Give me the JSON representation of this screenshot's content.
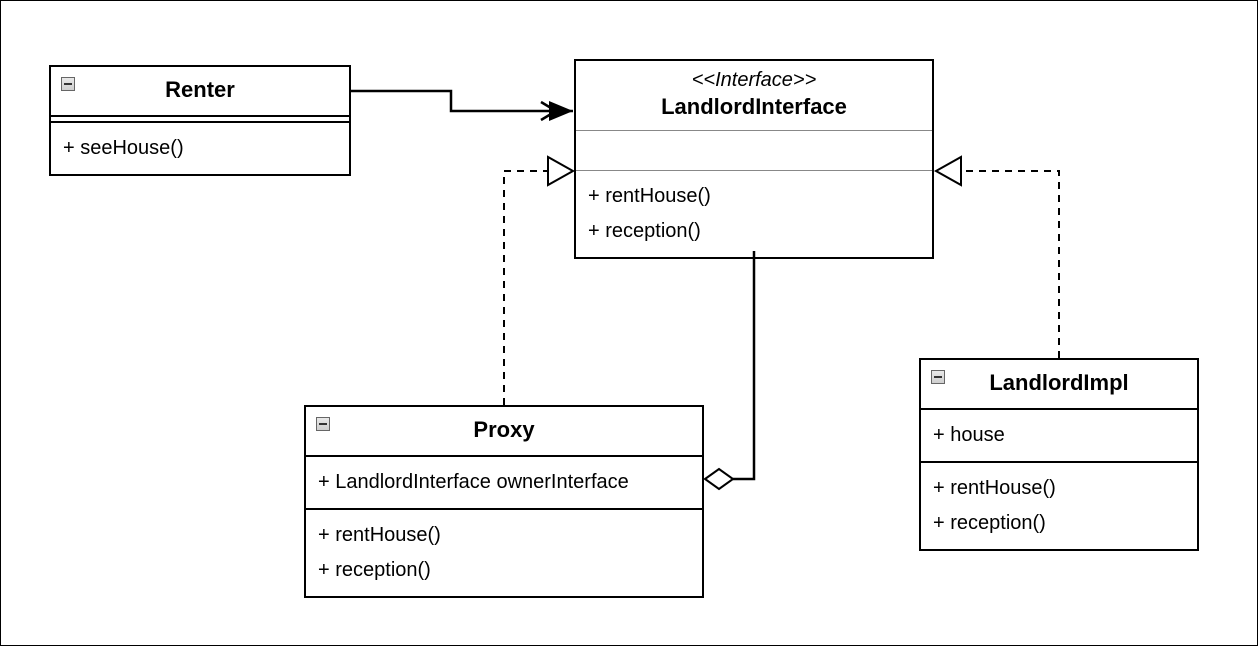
{
  "diagram_type": "UML Class Diagram",
  "classes": {
    "renter": {
      "name": "Renter",
      "methods": [
        "+ seeHouse()"
      ]
    },
    "landlordInterface": {
      "stereotype": "<<Interface>>",
      "name": "LandlordInterface",
      "methods": [
        "+ rentHouse()",
        "+ reception()"
      ]
    },
    "proxy": {
      "name": "Proxy",
      "attributes": [
        "+ LandlordInterface ownerInterface"
      ],
      "methods": [
        "+ rentHouse()",
        "+ reception()"
      ]
    },
    "landlordImpl": {
      "name": "LandlordImpl",
      "attributes": [
        "+ house"
      ],
      "methods": [
        "+ rentHouse()",
        "+ reception()"
      ]
    }
  },
  "relationships": [
    {
      "from": "Renter",
      "to": "LandlordInterface",
      "type": "association-directed"
    },
    {
      "from": "Proxy",
      "to": "LandlordInterface",
      "type": "realization"
    },
    {
      "from": "LandlordImpl",
      "to": "LandlordInterface",
      "type": "realization"
    },
    {
      "from": "Proxy",
      "to": "LandlordInterface",
      "type": "aggregation"
    }
  ]
}
